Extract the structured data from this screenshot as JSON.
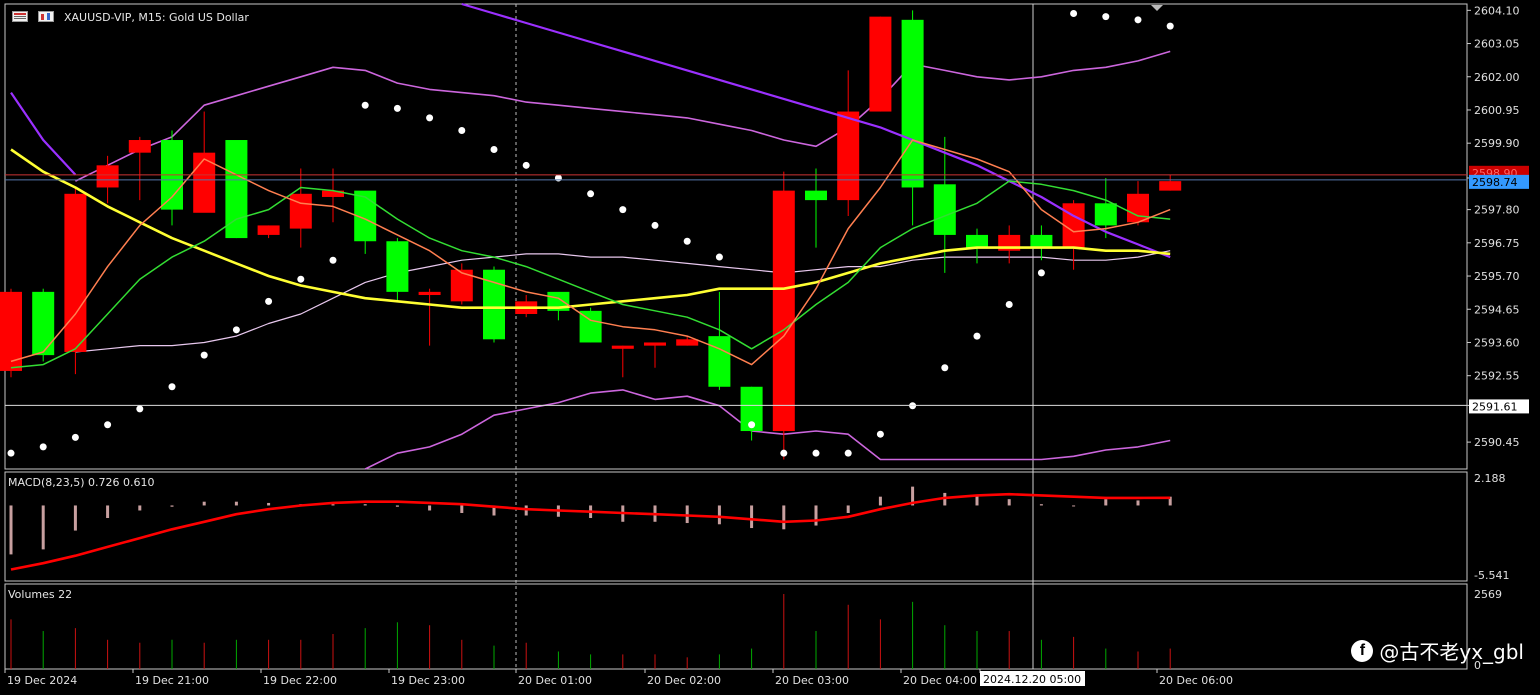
{
  "header": {
    "symbol": "XAUUSD-VIP",
    "timeframe": "M15",
    "description": "Gold US Dollar",
    "text": "XAUUSD-VIP, M15:  Gold US Dollar"
  },
  "watermark": {
    "text": "@古不老yx_gbl"
  },
  "colors": {
    "background": "#000000",
    "bull": "#00ff00",
    "bear": "#ff0000",
    "ma_fast": "#ff7f50",
    "ma_mid": "#33dd33",
    "ma_slow": "#ffff33",
    "ma_long": "#9b30ff",
    "bands": "#cc66dd",
    "bands_mid": "#e8c8ee",
    "sar": "#ffffff",
    "macd_signal": "#ff0000",
    "macd_hist": "#c8a0a0",
    "ask_line": "#3399ff",
    "bid_line": "#cc3333"
  },
  "chart_data": [
    {
      "type": "candlestick",
      "title": "XAUUSD-VIP, M15:  Gold US Dollar",
      "ylim": [
        2589.6,
        2604.3
      ],
      "y_ticks": [
        "2604.10",
        "2603.05",
        "2602.00",
        "2600.95",
        "2599.90",
        "2598.80",
        "2597.80",
        "2596.75",
        "2595.70",
        "2594.65",
        "2593.60",
        "2592.55",
        "2591.61",
        "2590.45"
      ],
      "current_bid": "2598.74",
      "current_ask_label": "2598.90",
      "crosshair_price": "2591.61",
      "x_ticks": [
        "19 Dec 2024",
        "19 Dec 21:00",
        "19 Dec 22:00",
        "19 Dec 23:00",
        "20 Dec 01:00",
        "20 Dec 02:00",
        "20 Dec 03:00",
        "20 Dec 04:00",
        "2024.12.20 05:00",
        "20 Dec 06:00"
      ],
      "candles": [
        {
          "o": 2595.2,
          "h": 2595.3,
          "l": 2592.5,
          "c": 2592.7
        },
        {
          "o": 2593.2,
          "h": 2595.3,
          "l": 2593.0,
          "c": 2595.2
        },
        {
          "o": 2598.3,
          "h": 2598.5,
          "l": 2592.6,
          "c": 2593.3
        },
        {
          "o": 2599.2,
          "h": 2599.5,
          "l": 2598.0,
          "c": 2598.5
        },
        {
          "o": 2600.0,
          "h": 2600.1,
          "l": 2598.1,
          "c": 2599.6
        },
        {
          "o": 2597.8,
          "h": 2600.3,
          "l": 2597.3,
          "c": 2600.0
        },
        {
          "o": 2599.6,
          "h": 2600.9,
          "l": 2597.8,
          "c": 2597.7
        },
        {
          "o": 2596.9,
          "h": 2598.3,
          "l": 2596.9,
          "c": 2600.0
        },
        {
          "o": 2597.3,
          "h": 2597.3,
          "l": 2596.9,
          "c": 2597.0
        },
        {
          "o": 2598.3,
          "h": 2599.1,
          "l": 2596.6,
          "c": 2597.2
        },
        {
          "o": 2598.4,
          "h": 2599.1,
          "l": 2597.4,
          "c": 2598.2
        },
        {
          "o": 2596.8,
          "h": 2598.3,
          "l": 2596.4,
          "c": 2598.4
        },
        {
          "o": 2595.2,
          "h": 2596.9,
          "l": 2594.9,
          "c": 2596.8
        },
        {
          "o": 2595.2,
          "h": 2595.3,
          "l": 2593.5,
          "c": 2595.1
        },
        {
          "o": 2595.9,
          "h": 2596.1,
          "l": 2594.8,
          "c": 2594.9
        },
        {
          "o": 2593.7,
          "h": 2596.0,
          "l": 2593.6,
          "c": 2595.9
        },
        {
          "o": 2594.9,
          "h": 2595.1,
          "l": 2594.4,
          "c": 2594.5
        },
        {
          "o": 2594.6,
          "h": 2595.1,
          "l": 2594.3,
          "c": 2595.2
        },
        {
          "o": 2593.6,
          "h": 2594.7,
          "l": 2593.6,
          "c": 2594.6
        },
        {
          "o": 2593.5,
          "h": 2593.5,
          "l": 2592.5,
          "c": 2593.4
        },
        {
          "o": 2593.6,
          "h": 2593.6,
          "l": 2592.8,
          "c": 2593.5
        },
        {
          "o": 2593.7,
          "h": 2593.8,
          "l": 2593.5,
          "c": 2593.5
        },
        {
          "o": 2592.2,
          "h": 2595.2,
          "l": 2592.1,
          "c": 2593.8
        },
        {
          "o": 2590.8,
          "h": 2592.2,
          "l": 2590.5,
          "c": 2592.2
        },
        {
          "o": 2598.4,
          "h": 2599.0,
          "l": 2589.9,
          "c": 2590.8
        },
        {
          "o": 2598.1,
          "h": 2599.1,
          "l": 2596.6,
          "c": 2598.4
        },
        {
          "o": 2600.9,
          "h": 2602.2,
          "l": 2597.6,
          "c": 2598.1
        },
        {
          "o": 2603.9,
          "h": 2603.9,
          "l": 2600.9,
          "c": 2600.9
        },
        {
          "o": 2598.5,
          "h": 2604.1,
          "l": 2597.3,
          "c": 2603.8
        },
        {
          "o": 2597.0,
          "h": 2600.1,
          "l": 2595.8,
          "c": 2598.6
        },
        {
          "o": 2596.6,
          "h": 2597.2,
          "l": 2596.1,
          "c": 2597.0
        },
        {
          "o": 2597.0,
          "h": 2597.3,
          "l": 2596.1,
          "c": 2596.5
        },
        {
          "o": 2596.6,
          "h": 2597.3,
          "l": 2596.2,
          "c": 2597.0
        },
        {
          "o": 2598.0,
          "h": 2598.1,
          "l": 2595.9,
          "c": 2596.6
        },
        {
          "o": 2597.3,
          "h": 2598.8,
          "l": 2596.9,
          "c": 2598.0
        },
        {
          "o": 2598.3,
          "h": 2598.7,
          "l": 2597.3,
          "c": 2597.4
        },
        {
          "o": 2598.7,
          "h": 2598.9,
          "l": 2598.4,
          "c": 2598.4
        }
      ],
      "series": [
        {
          "id": "ma_fast",
          "values": [
            2593.0,
            2593.3,
            2594.5,
            2596.0,
            2597.3,
            2598.2,
            2599.4,
            2598.9,
            2598.4,
            2598.0,
            2597.9,
            2597.5,
            2597.0,
            2596.5,
            2595.8,
            2595.5,
            2595.2,
            2595.0,
            2594.3,
            2594.1,
            2594.0,
            2593.8,
            2593.4,
            2592.9,
            2593.8,
            2595.3,
            2597.2,
            2598.5,
            2600.0,
            2599.7,
            2599.4,
            2599.0,
            2597.8,
            2597.1,
            2597.2,
            2597.4,
            2597.8
          ]
        },
        {
          "id": "ma_mid",
          "values": [
            2592.8,
            2592.9,
            2593.4,
            2594.5,
            2595.6,
            2596.3,
            2596.8,
            2597.5,
            2597.8,
            2598.5,
            2598.4,
            2598.2,
            2597.5,
            2596.9,
            2596.5,
            2596.3,
            2596.0,
            2595.6,
            2595.2,
            2594.8,
            2594.6,
            2594.4,
            2594.0,
            2593.4,
            2594.0,
            2594.8,
            2595.5,
            2596.6,
            2597.2,
            2597.6,
            2598.0,
            2598.7,
            2598.6,
            2598.4,
            2598.1,
            2597.6,
            2597.5
          ]
        },
        {
          "id": "ma_slow",
          "values": [
            2599.7,
            2599.0,
            2598.5,
            2597.9,
            2597.4,
            2596.9,
            2596.5,
            2596.1,
            2595.7,
            2595.4,
            2595.2,
            2595.0,
            2594.9,
            2594.8,
            2594.7,
            2594.7,
            2594.7,
            2594.7,
            2594.8,
            2594.9,
            2595.0,
            2595.1,
            2595.3,
            2595.3,
            2595.3,
            2595.5,
            2595.8,
            2596.1,
            2596.3,
            2596.5,
            2596.6,
            2596.6,
            2596.6,
            2596.6,
            2596.5,
            2596.5,
            2596.4
          ]
        },
        {
          "id": "ma_long",
          "values": [
            2601.5,
            2600.0,
            2598.9,
            null,
            null,
            null,
            null,
            null,
            null,
            null,
            null,
            null,
            null,
            null,
            2604.3,
            2604.0,
            2603.7,
            2603.4,
            2603.1,
            2602.8,
            2602.5,
            2602.2,
            2601.9,
            2601.6,
            2601.3,
            2601.0,
            2600.7,
            2600.4,
            2600.0,
            2599.6,
            2599.2,
            2598.7,
            2598.2,
            2597.6,
            2597.1,
            2596.7,
            2596.3
          ]
        },
        {
          "id": "bands_upper",
          "values": [
            null,
            null,
            2598.7,
            2599.2,
            2599.7,
            2600.1,
            2601.1,
            2601.4,
            2601.7,
            2602.0,
            2602.3,
            2602.2,
            2601.8,
            2601.6,
            2601.5,
            2601.4,
            2601.2,
            2601.1,
            2601.0,
            2600.9,
            2600.8,
            2600.7,
            2600.5,
            2600.3,
            2600.0,
            2599.8,
            2600.4,
            2601.3,
            2602.4,
            2602.2,
            2602.0,
            2601.9,
            2602.0,
            2602.2,
            2602.3,
            2602.5,
            2602.8
          ]
        },
        {
          "id": "bands_middle",
          "values": [
            null,
            null,
            2593.3,
            2593.4,
            2593.5,
            2593.5,
            2593.6,
            2593.8,
            2594.2,
            2594.5,
            2595.0,
            2595.5,
            2595.8,
            2596.0,
            2596.2,
            2596.3,
            2596.4,
            2596.4,
            2596.3,
            2596.3,
            2596.2,
            2596.1,
            2596.0,
            2595.9,
            2595.8,
            2595.9,
            2596.0,
            2596.0,
            2596.2,
            2596.3,
            2596.3,
            2596.3,
            2596.3,
            2596.2,
            2596.2,
            2596.3,
            2596.5
          ]
        },
        {
          "id": "bands_lower",
          "values": [
            null,
            null,
            null,
            null,
            null,
            null,
            null,
            null,
            null,
            null,
            null,
            2589.6,
            2590.1,
            2590.3,
            2590.7,
            2591.3,
            2591.5,
            2591.7,
            2592.0,
            2592.1,
            2591.8,
            2591.9,
            2591.6,
            2590.8,
            2590.7,
            2590.8,
            2590.7,
            2589.9,
            2589.9,
            2589.9,
            2589.9,
            2589.9,
            2589.9,
            2590.0,
            2590.2,
            2590.3,
            2590.5
          ]
        },
        {
          "id": "sar",
          "values": [
            2590.1,
            2590.3,
            2590.6,
            2591.0,
            2591.5,
            2592.2,
            2593.2,
            2594.0,
            2594.9,
            2595.6,
            2596.2,
            2601.1,
            2601.0,
            2600.7,
            2600.3,
            2599.7,
            2599.2,
            2598.8,
            2598.3,
            2597.8,
            2597.3,
            2596.8,
            2596.3,
            2591.0,
            2590.1,
            2590.1,
            2590.1,
            2590.7,
            2591.6,
            2592.8,
            2593.8,
            2594.8,
            2595.8,
            2604.0,
            2603.9,
            2603.8,
            2603.6
          ]
        }
      ]
    },
    {
      "type": "bar",
      "title": "MACD(8,23,5) 0.726 0.610",
      "ylim": [
        -5.541,
        2.188
      ],
      "y_ticks": [
        "2.188",
        "-5.541"
      ],
      "series": [
        {
          "id": "macd_main",
          "values": [
            -3.9,
            -3.5,
            -2.0,
            -1.0,
            -0.4,
            -0.1,
            0.3,
            0.3,
            0.2,
            0.1,
            0.1,
            0.1,
            -0.1,
            -0.4,
            -0.6,
            -0.8,
            -0.8,
            -0.9,
            -1.0,
            -1.3,
            -1.3,
            -1.4,
            -1.5,
            -1.8,
            -1.9,
            -1.6,
            -0.6,
            0.7,
            1.5,
            1.0,
            0.8,
            0.5,
            0.1,
            0.0,
            0.5,
            0.4,
            0.7
          ]
        },
        {
          "id": "macd_signal",
          "values": [
            -5.1,
            -4.6,
            -4.0,
            -3.3,
            -2.6,
            -1.9,
            -1.3,
            -0.7,
            -0.3,
            0.0,
            0.2,
            0.3,
            0.3,
            0.2,
            0.1,
            -0.1,
            -0.3,
            -0.4,
            -0.5,
            -0.6,
            -0.7,
            -0.8,
            -0.9,
            -1.1,
            -1.3,
            -1.2,
            -0.9,
            -0.3,
            0.2,
            0.6,
            0.8,
            0.9,
            0.8,
            0.7,
            0.6,
            0.6,
            0.61
          ]
        }
      ]
    },
    {
      "type": "bar",
      "title": "Volumes 22",
      "ylim": [
        0,
        2569
      ],
      "y_ticks": [
        "2569",
        "0"
      ],
      "series": [
        {
          "id": "volumes",
          "values": [
            1700,
            1300,
            1400,
            1000,
            900,
            1000,
            900,
            1000,
            1000,
            1000,
            1200,
            1400,
            1600,
            1500,
            1000,
            800,
            900,
            600,
            500,
            500,
            500,
            400,
            500,
            700,
            2569,
            1300,
            2200,
            1700,
            2300,
            1500,
            1300,
            1300,
            1000,
            1100,
            700,
            600,
            700
          ]
        }
      ]
    }
  ]
}
